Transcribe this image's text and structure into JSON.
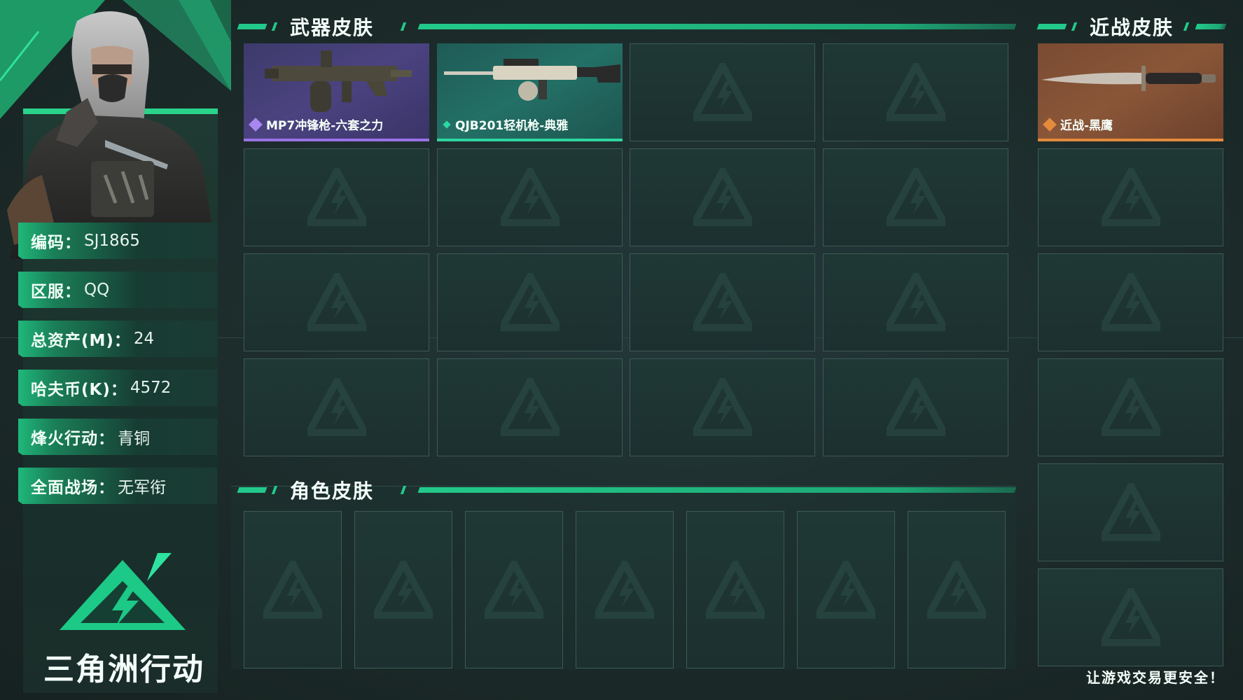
{
  "sections": {
    "weapon_title": "武器皮肤",
    "melee_title": "近战皮肤",
    "role_title": "角色皮肤"
  },
  "profile": {
    "rows": [
      {
        "key": "编码：",
        "value": "SJ1865"
      },
      {
        "key": "区服：",
        "value": "QQ"
      },
      {
        "key": "总资产(M)：",
        "value": "24"
      },
      {
        "key": "哈夫币(K)：",
        "value": "4572"
      },
      {
        "key": "烽火行动：",
        "value": "青铜"
      },
      {
        "key": "全面战场：",
        "value": "无军衔"
      }
    ]
  },
  "weapon_items": [
    {
      "label": "MP7冲锋枪-六套之力",
      "rarity": "purple",
      "icon": "smg-icon"
    },
    {
      "label": "QJB201轻机枪-典雅",
      "rarity": "green",
      "icon": "machine-gun-icon"
    }
  ],
  "melee_items": [
    {
      "label": "近战-黑鹰",
      "rarity": "orange",
      "icon": "knife-icon"
    }
  ],
  "logo": {
    "text": "三角洲行动"
  },
  "slogan": "让游戏交易更安全！",
  "colors": {
    "accent": "#22c98a",
    "purple": "#9a72e6",
    "green": "#2ed6a0",
    "orange": "#e38a3c",
    "background": "#1c2b2a"
  }
}
